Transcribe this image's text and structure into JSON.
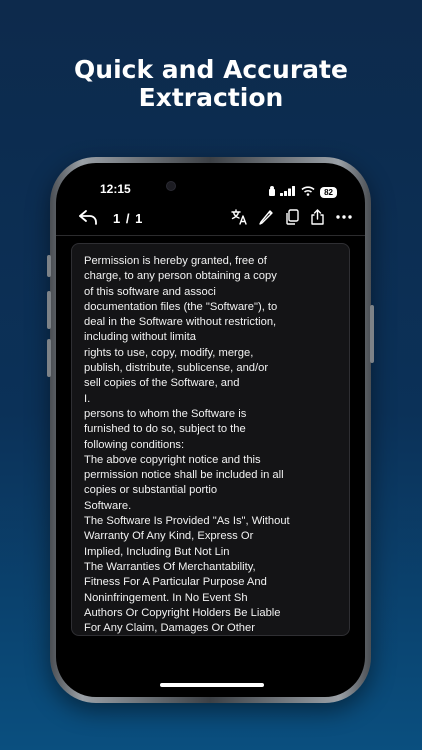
{
  "headline": {
    "line1": "Quick and Accurate",
    "line2": "Extraction"
  },
  "status_bar": {
    "time": "12:15",
    "battery": "82",
    "icons": [
      "notification-icon",
      "signal-icon",
      "wifi-icon",
      "battery-icon"
    ]
  },
  "toolbar": {
    "back_icon": "undo-arrow-icon",
    "page_indicator": "1 / 1",
    "actions": [
      "translate-icon",
      "pen-icon",
      "copy-icon",
      "share-icon",
      "more-icon"
    ]
  },
  "extracted_text": {
    "lines": [
      "Permission is hereby granted, free of",
      "charge, to any person obtaining a copy",
      "of this software and associ",
      "documentation files (the \"Software\"), to",
      "deal in the Software without restriction,",
      "including without limita",
      "rights to use, copy, modify, merge,",
      "publish, distribute, sublicense, and/or",
      "sell copies of the Software, and",
      "I.",
      "persons to whom the Software is",
      "furnished to do so, subject to the",
      "following conditions:",
      "The above copyright notice and this",
      "permission notice shall be included in all",
      "copies or substantial portio",
      "Software.",
      "The Software Is Provided \"As Is\", Without",
      "Warranty Of Any Kind, Express Or",
      "Implied, Including But Not Lin",
      "The Warranties Of Merchantability,",
      "Fitness For A Particular Purpose And",
      "Noninfringement. In No Event Sh",
      "Authors Or Copyright Holders Be Liable",
      "For Any Claim, Damages Or Other"
    ]
  },
  "colors": {
    "background_top": "#0d2a4c",
    "background_bottom": "#0a4f7f",
    "screen": "#000000",
    "text": "#f2f2f2"
  }
}
